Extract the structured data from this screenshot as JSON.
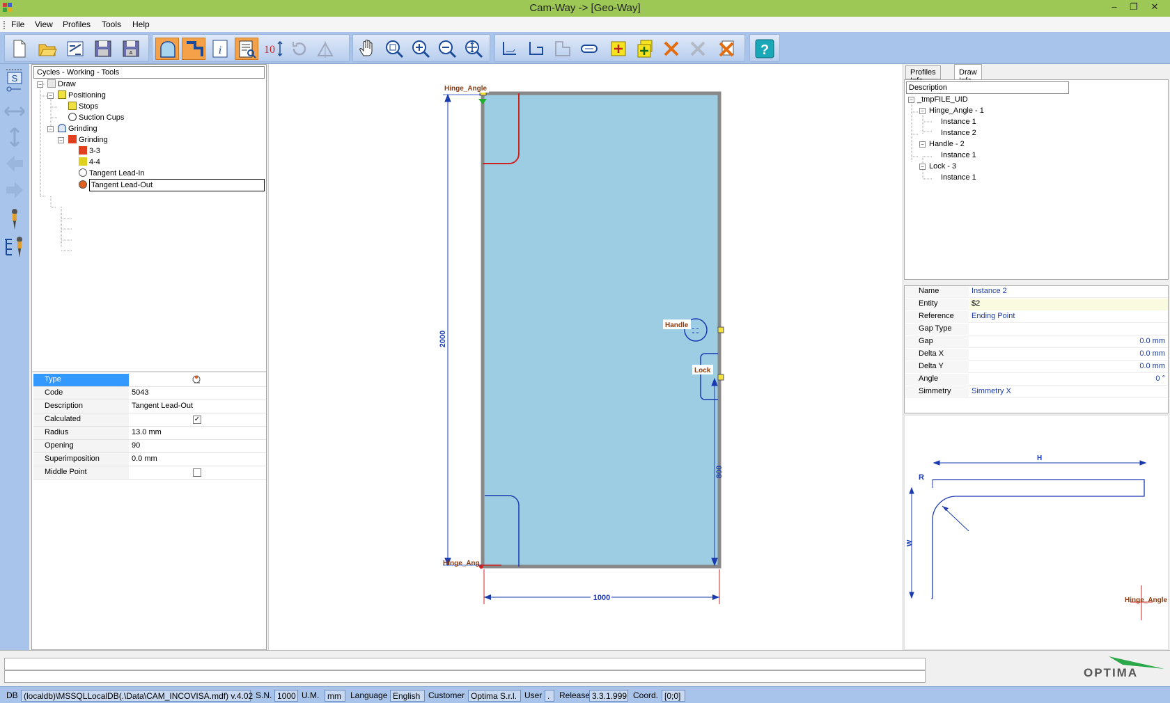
{
  "window": {
    "title": "Cam-Way -> [Geo-Way]"
  },
  "menu": [
    "File",
    "View",
    "Profiles",
    "Tools",
    "Help"
  ],
  "toolbar": {
    "zoom_label": "10"
  },
  "left_panel": {
    "header": "Cycles - Working - Tools",
    "tree": [
      "Draw",
      "Positioning",
      "Stops",
      "Suction Cups",
      "Grinding",
      "Grinding",
      "3-3",
      "4-4",
      "Tangent Lead-In",
      "Tangent Lead-Out"
    ],
    "properties": [
      {
        "key": "Type",
        "value": ""
      },
      {
        "key": "Code",
        "value": "5043"
      },
      {
        "key": "Description",
        "value": "Tangent Lead-Out"
      },
      {
        "key": "Calculated",
        "value": ""
      },
      {
        "key": "Radius",
        "value": "13.0 mm"
      },
      {
        "key": "Opening",
        "value": "90"
      },
      {
        "key": "Superimposition",
        "value": "0.0 mm"
      },
      {
        "key": "Middle Point",
        "value": ""
      }
    ],
    "calculated_checked": true,
    "middle_point_checked": false
  },
  "canvas": {
    "label_hinge_top": "Hinge_Angle",
    "label_hinge_bottom": "Hinge_Ang",
    "label_handle": "Handle",
    "label_lock": "Lock",
    "dim_height": "2000",
    "dim_width": "1000",
    "dim_side": "800",
    "panel_color": "#9dcde3"
  },
  "right_panel": {
    "tabs": [
      "Profiles Info",
      "Draw Info"
    ],
    "active_tab": "Draw Info",
    "tree_header": "Description",
    "tree": [
      "_tmpFILE_UID",
      "Hinge_Angle - 1",
      "Instance 1",
      "Instance 2",
      "Handle - 2",
      "Instance 1",
      "Lock - 3",
      "Instance 1"
    ],
    "properties": [
      {
        "key": "Name",
        "value": "Instance 2"
      },
      {
        "key": "Entity",
        "value": "$2"
      },
      {
        "key": "Reference",
        "value": "Ending Point"
      },
      {
        "key": "Gap Type",
        "value": ""
      },
      {
        "key": "Gap",
        "value": "0.0 mm"
      },
      {
        "key": "Delta X",
        "value": "0.0 mm"
      },
      {
        "key": "Delta Y",
        "value": "0.0 mm"
      },
      {
        "key": "Angle",
        "value": "0 °"
      },
      {
        "key": "Simmetry",
        "value": "Simmetry X"
      }
    ],
    "diagram": {
      "label_r": "R",
      "label_h": "H",
      "label_w": "W",
      "label_hinge": "Hinge_Angle"
    }
  },
  "bottom": {
    "logo_text": "OPTIMA"
  },
  "status": {
    "db_label": "DB",
    "db_value": "(localdb)\\MSSQLLocalDB(.\\Data\\CAM_INCOVISA.mdf) v.4.02",
    "sn_label": "S.N.",
    "sn_value": "1000",
    "um_label": "U.M.",
    "um_value": "mm",
    "lang_label": "Language",
    "lang_value": "English",
    "cust_label": "Customer",
    "cust_value": "Optima S.r.l.",
    "user_label": "User",
    "user_value": ".",
    "rel_label": "Release",
    "rel_value": "3.3.1.999",
    "coord_label": "Coord.",
    "coord_value": "[0;0]"
  }
}
